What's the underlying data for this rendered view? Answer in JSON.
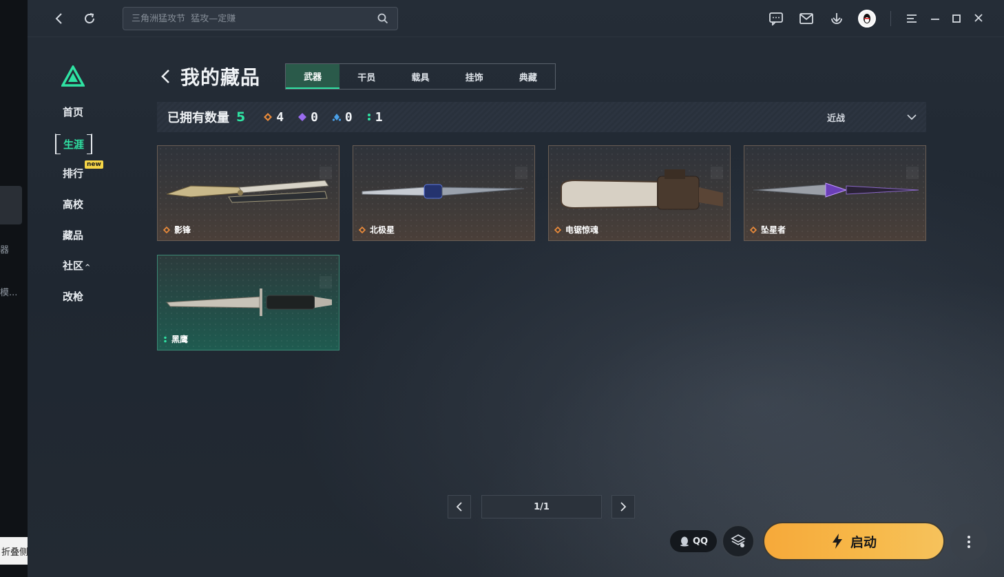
{
  "outer": {
    "snippet1": "器",
    "snippet2": "模...",
    "collapse_tip": "折叠侧边栏"
  },
  "search": {
    "placeholder": "三角洲猛攻节  猛攻—定赚"
  },
  "nav": {
    "items": [
      "首页",
      "生涯",
      "排行",
      "高校",
      "藏品",
      "社区",
      "改枪"
    ],
    "new_badge": "new",
    "community_suffix": "^"
  },
  "header": {
    "title": "我的藏品"
  },
  "tabs": [
    "武器",
    "干员",
    "载具",
    "挂饰",
    "典藏"
  ],
  "stats": {
    "label": "已拥有数量",
    "total": "5",
    "gold": "4",
    "purple": "0",
    "blue": "0",
    "green": "1",
    "filter": "近战"
  },
  "cards": [
    {
      "name": "影锋",
      "rarity": "gold"
    },
    {
      "name": "北极星",
      "rarity": "gold"
    },
    {
      "name": "电锯惊魂",
      "rarity": "gold"
    },
    {
      "name": "坠星者",
      "rarity": "gold"
    },
    {
      "name": "黑鹰",
      "rarity": "green"
    }
  ],
  "pagination": {
    "current": "1/1"
  },
  "bottom": {
    "qq_label": "QQ",
    "launch_label": "启动"
  },
  "colors": {
    "accent": "#2fe3a3",
    "launch": "#f6a93a",
    "gold_rarity": "#e98a3a",
    "purple_rarity": "#9a6cf0",
    "blue_rarity": "#4aa0e8"
  }
}
